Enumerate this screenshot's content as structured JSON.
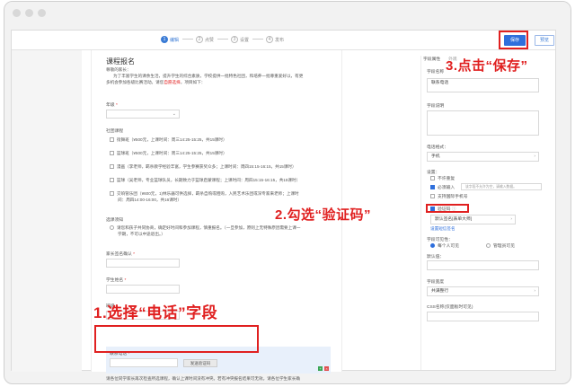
{
  "steps": [
    {
      "num": "1",
      "label": "编辑",
      "active": true
    },
    {
      "num": "2",
      "label": "点赞",
      "active": false
    },
    {
      "num": "3",
      "label": "设置",
      "active": false
    },
    {
      "num": "4",
      "label": "发布",
      "active": false
    }
  ],
  "toolbar": {
    "save_label": "保存",
    "preview_label": "预览"
  },
  "form": {
    "title": "课程报名",
    "greeting": "尊敬的家长：",
    "intro_line1": "为了丰富学生的课余生活，提升学生的综合素质，学校提供一批特色社团，和培养一批尊重爱好以，有更",
    "intro_line2a": "多机会参加各级比赛活动。请您",
    "intro_red": "自愿选择",
    "intro_line2b": "，项目如下：",
    "grade_label": "年级",
    "club_label": "社团课程",
    "clubs": [
      "街舞班（¥500元，上课时间：周三14:25-15:25，共15课时）",
      "篮球班（¥500元，上课时间：周三14:25-15:25，共15课时）",
      "漫画（李老师，羁杀教学经验丰富，学生参赛获奖众多；上课时间：周四15:15-16:15，共15课时）",
      "篮球（吴老师，专业篮球队员，长期致力于篮球启蒙课程；上课时间：周四15:15-16:15，共15课时）",
      "交响管乐团（¥600元，1)林乐器可供选择，羁杀自购或租购，入民艺术乐团或深专家来老师；上课时",
      "间：周四14:00-16:00，共16课时）"
    ],
    "notice_label": "选课须知",
    "notice_line1": "请您和孩子共同协商，确定好时间和参加课程，慎重报名。（一旦参加，原则上无特殊原因需要上课一",
    "notice_line2": "学期，不可以中途退出。）",
    "parent_label": "家长签名确认",
    "student_label": "学生姓名",
    "class_label": "班级",
    "phone_label": "联系电话",
    "send_code_label": "发送验证码",
    "footer_line1": "请各位同学家长再次检查所选课程，确认上课时间没有冲突。若有冲突报名结果可无效。请各位学生家长确",
    "footer_line2": "认正确后提交！"
  },
  "right": {
    "tab_prop": "字段属性",
    "tab_style": "外观",
    "name_label": "字段名称",
    "name_value": "联系电话",
    "desc_label": "字段说明",
    "format_label": "电话格式：",
    "format_value": "手机",
    "settings_label": "设置：",
    "no_repeat": "不许重复",
    "required": "必须输入",
    "required_placeholder": "该字段不允许为空，请输入数据。",
    "intl": "支持国际手机号",
    "verify": "验证码",
    "verify_select": "默认签名[表单大师]",
    "verify_link": "设置短信签名",
    "visible_label": "字段可见性：",
    "visible_all": "每个人可见",
    "visible_admin": "管理员可见",
    "default_label": "默认值：",
    "width_label": "字段宽度",
    "width_value": "共满整行",
    "css_label": "CSS名称(仅面板时可见)"
  },
  "annotations": {
    "a1": "1.选择“电话”字段",
    "a2": "2.勾选“验证码”",
    "a3": "3.点击“保存”"
  },
  "colors": {
    "accent": "#2f6fdc",
    "annotation": "#e02020"
  }
}
